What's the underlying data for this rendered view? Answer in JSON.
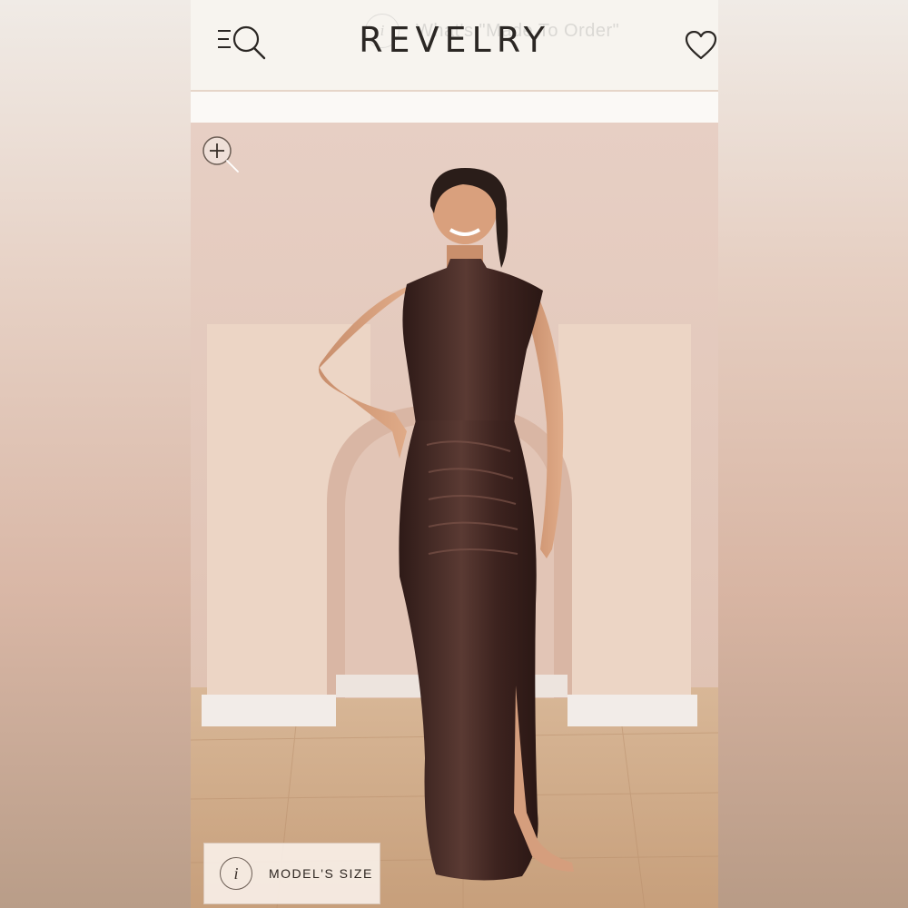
{
  "header": {
    "brand": "REVELRY",
    "banner_text": "What's \"Made To Order\"",
    "banner_icon": "i",
    "menu_search_icon": "menu-search-icon",
    "wishlist_icon": "heart-icon"
  },
  "product_image": {
    "zoom_icon": "zoom-in-icon",
    "model_size_icon": "i",
    "model_size_label": "MODEL'S SIZE"
  },
  "colors": {
    "background": "#f7f4ef",
    "header_border": "#e6d6c9",
    "logo": "#2b2724",
    "wall": "#e3c8bb",
    "dress": "#3d231f",
    "floor": "#c9a582"
  }
}
